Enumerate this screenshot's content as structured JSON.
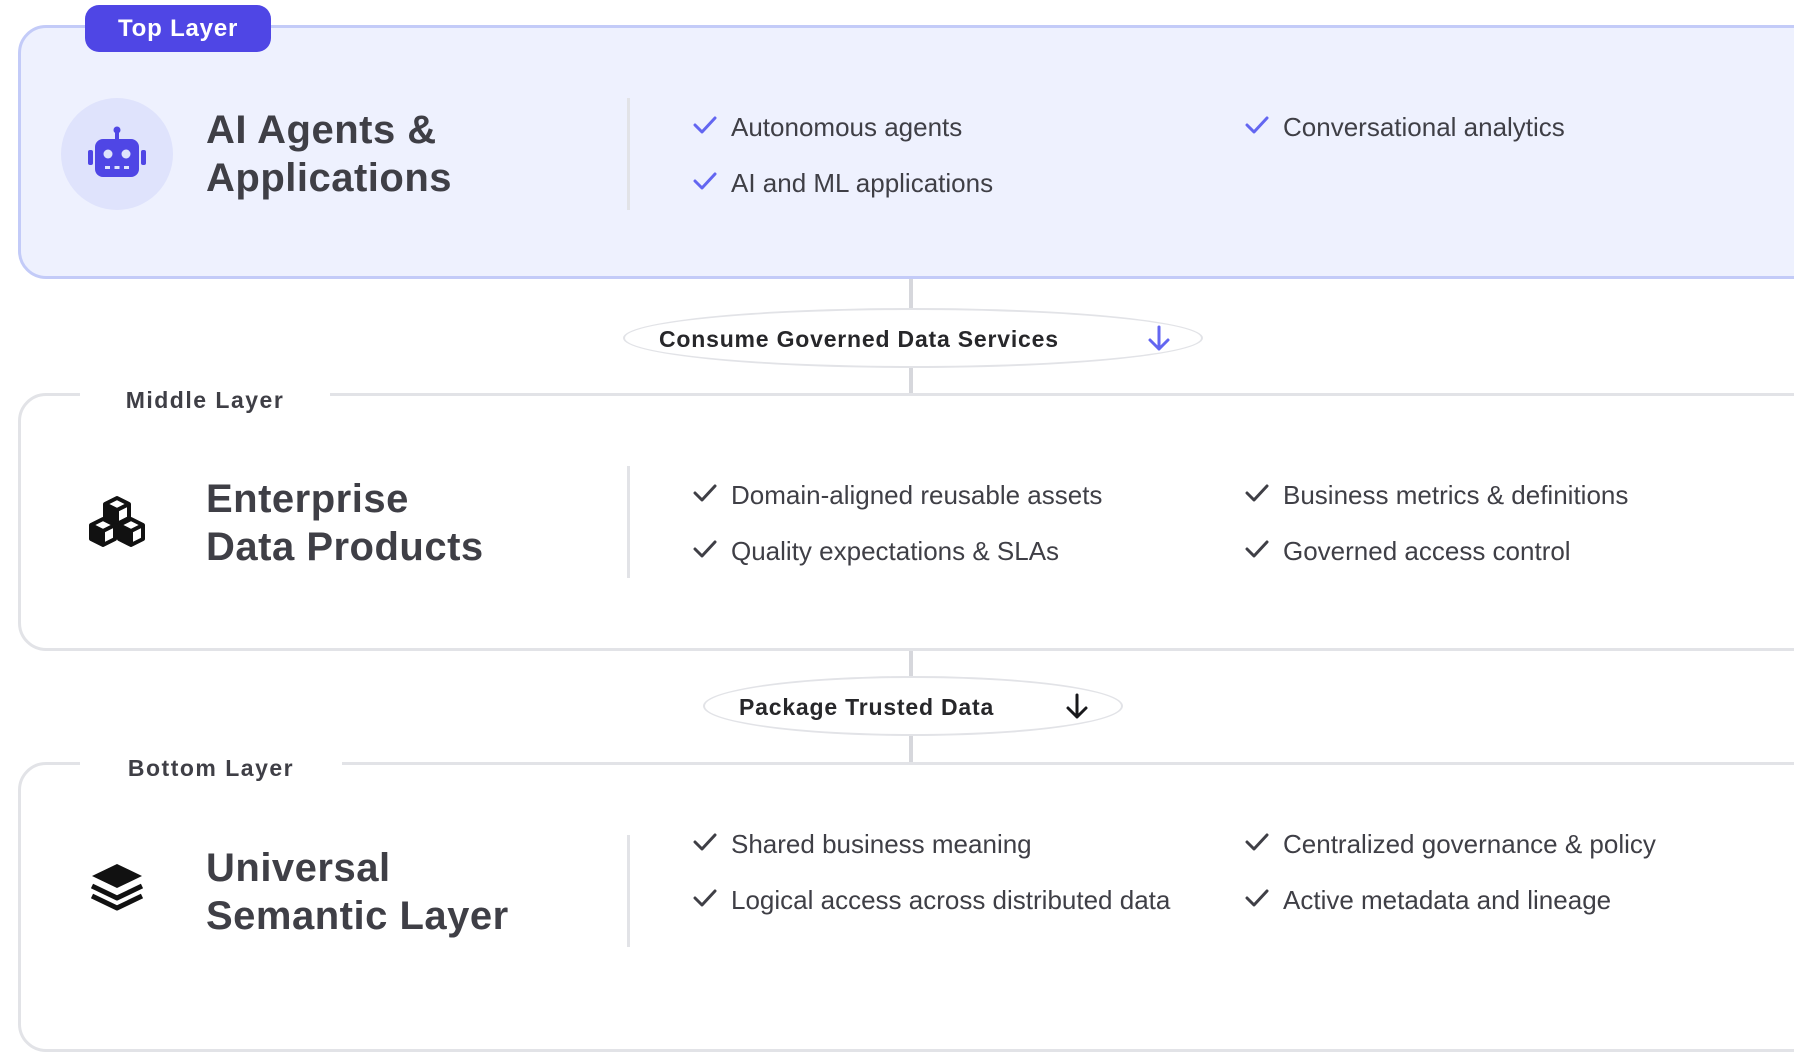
{
  "layers": [
    {
      "tag": "Top Layer",
      "icon": "robot-icon",
      "title_lines": [
        "AI Agents &",
        "Applications"
      ],
      "features": [
        "Autonomous agents",
        "Conversational analytics",
        "AI and ML applications"
      ]
    },
    {
      "tag": "Middle Layer",
      "icon": "cubes-icon",
      "title_lines": [
        "Enterprise",
        "Data Products"
      ],
      "features": [
        "Domain-aligned reusable assets",
        "Business metrics & definitions",
        "Quality expectations & SLAs",
        "Governed access control"
      ]
    },
    {
      "tag": "Bottom Layer",
      "icon": "layers-icon",
      "title_lines": [
        "Universal",
        "Semantic Layer"
      ],
      "features": [
        "Shared business meaning",
        "Centralized governance & policy",
        "Logical access across distributed data",
        "Active metadata and lineage"
      ]
    }
  ],
  "connectors": [
    {
      "label": "Consume Governed Data Services",
      "arrow": "arrow-down-icon",
      "color": "#6366f1"
    },
    {
      "label": "Package Trusted Data",
      "arrow": "arrow-down-icon",
      "color": "#18181b"
    }
  ],
  "colors": {
    "accent": "#4f46e5",
    "accent_light": "#eef1fe",
    "accent_border": "#c3cbf8",
    "neutral_border": "#e2e3e7",
    "text": "#3f3f46"
  }
}
